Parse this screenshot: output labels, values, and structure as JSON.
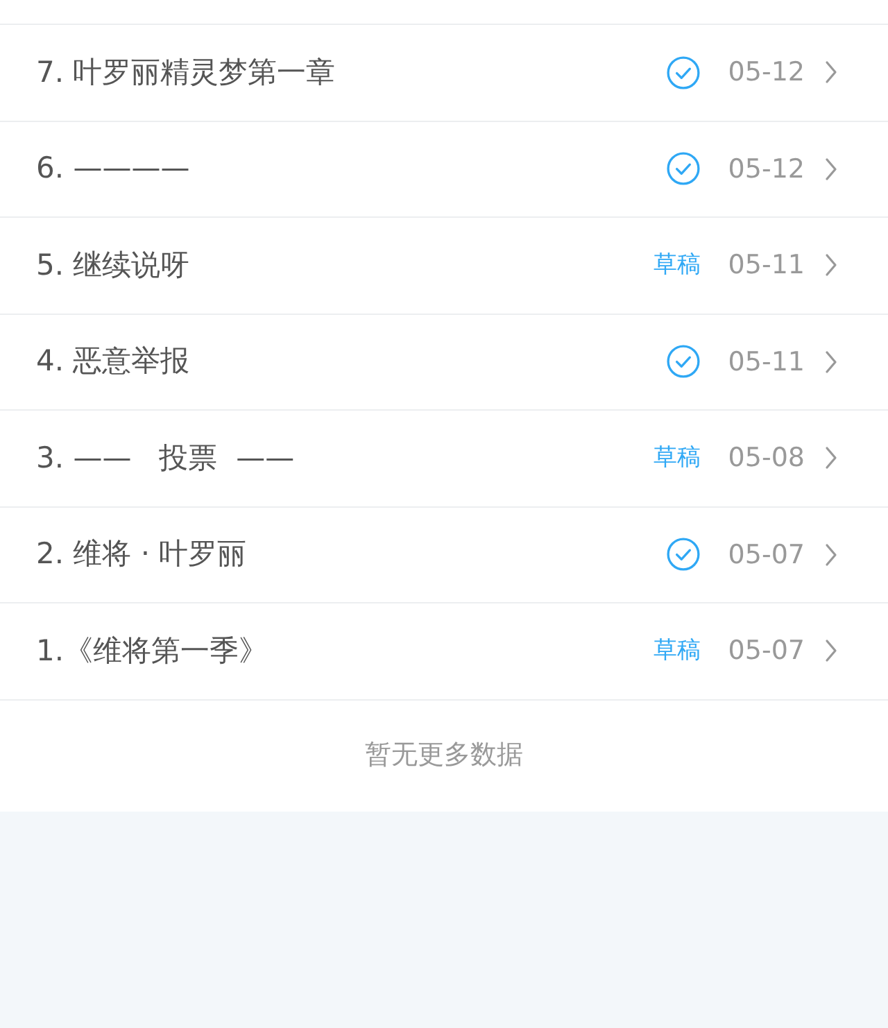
{
  "rows": [
    {
      "title": "7. 叶罗丽精灵梦第一章",
      "kind": "published",
      "date": "05-12"
    },
    {
      "title": "6. ————",
      "kind": "published",
      "date": "05-12"
    },
    {
      "title": "5. 继续说呀",
      "kind": "draft",
      "status_label": "草稿",
      "date": "05-11"
    },
    {
      "title": "4. 恶意举报",
      "kind": "published",
      "date": "05-11"
    },
    {
      "title": "3. ——   投票  ——",
      "kind": "draft",
      "status_label": "草稿",
      "date": "05-08"
    },
    {
      "title": "2. 维将 · 叶罗丽",
      "kind": "published",
      "date": "05-07"
    },
    {
      "title": "1.《维将第一季》",
      "kind": "draft",
      "status_label": "草稿",
      "date": "05-07"
    }
  ],
  "footer": "暂无更多数据"
}
